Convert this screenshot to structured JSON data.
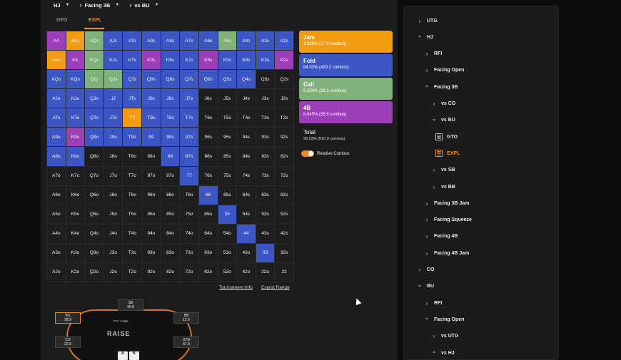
{
  "breadcrumb": [
    {
      "label": "HJ",
      "chev": false
    },
    {
      "label": "Facing 3B",
      "chev": true
    },
    {
      "label": "vs BU",
      "chev": true
    }
  ],
  "tabs": [
    "GTO",
    "EXPL"
  ],
  "active_tab": "EXPL",
  "colors": {
    "jam": "#f39c12",
    "fold": "#3d56c6",
    "call": "#7fb27a",
    "bet4": "#9c3fb8",
    "none": "#1e1e1e",
    "accent": "#f08a24"
  },
  "grid": {
    "rows": [
      [
        "AA",
        "AKs",
        "AQs",
        "AJs",
        "ATs",
        "A9s",
        "A8s",
        "A7s",
        "A6s",
        "A5s",
        "A4s",
        "A3s",
        "A2s"
      ],
      [
        "AKo",
        "KK",
        "KQs",
        "KJs",
        "KTs",
        "K9s",
        "K8s",
        "K7s",
        "K6s",
        "K5s",
        "K4s",
        "K3s",
        "K2s"
      ],
      [
        "AQo",
        "KQo",
        "QQ",
        "QJs",
        "QTs",
        "Q9s",
        "Q8s",
        "Q7s",
        "Q6s",
        "Q5s",
        "Q4s",
        "Q3s",
        "Q2s"
      ],
      [
        "AJo",
        "KJo",
        "QJo",
        "JJ",
        "JTs",
        "J9s",
        "J8s",
        "J7s",
        "J6s",
        "J5s",
        "J4s",
        "J3s",
        "J2s"
      ],
      [
        "ATo",
        "KTo",
        "QTo",
        "JTo",
        "TT",
        "T9s",
        "T8s",
        "T7s",
        "T6s",
        "T5s",
        "T4s",
        "T3s",
        "T2s"
      ],
      [
        "A9o",
        "K9o",
        "Q9o",
        "J9o",
        "T9o",
        "99",
        "98s",
        "97s",
        "96s",
        "95s",
        "94s",
        "93s",
        "92s"
      ],
      [
        "A8o",
        "K8o",
        "Q8o",
        "J8o",
        "T8o",
        "98o",
        "88",
        "87s",
        "86s",
        "85s",
        "84s",
        "83s",
        "82s"
      ],
      [
        "A7o",
        "K7o",
        "Q7o",
        "J7o",
        "T7o",
        "97o",
        "87o",
        "77",
        "76s",
        "75s",
        "74s",
        "73s",
        "72s"
      ],
      [
        "A6o",
        "K6o",
        "Q6o",
        "J6o",
        "T6o",
        "96o",
        "86o",
        "76o",
        "66",
        "65s",
        "64s",
        "63s",
        "62s"
      ],
      [
        "A5o",
        "K5o",
        "Q5o",
        "J5o",
        "T5o",
        "95o",
        "85o",
        "75o",
        "65o",
        "55",
        "54s",
        "53s",
        "52s"
      ],
      [
        "A4o",
        "K4o",
        "Q4o",
        "J4o",
        "T4o",
        "94o",
        "84o",
        "74o",
        "64o",
        "54o",
        "44",
        "43s",
        "42s"
      ],
      [
        "A3o",
        "K3o",
        "Q3o",
        "J3o",
        "T3o",
        "93o",
        "83o",
        "73o",
        "63o",
        "53o",
        "43o",
        "33",
        "32s"
      ],
      [
        "A2o",
        "K2o",
        "Q2o",
        "J2o",
        "T2o",
        "92o",
        "82o",
        "72o",
        "62o",
        "52o",
        "42o",
        "32o",
        "22"
      ]
    ],
    "colors": [
      [
        "bet4",
        "jam",
        "call",
        "fold",
        "fold",
        "fold",
        "fold",
        "fold",
        "fold",
        "call",
        "fold",
        "fold",
        "fold"
      ],
      [
        "jam",
        "bet4",
        "call",
        "fold",
        "fold",
        "bet4",
        "fold",
        "fold",
        "bet4",
        "fold",
        "fold",
        "fold",
        "bet4"
      ],
      [
        "fold",
        "fold",
        "call",
        "call",
        "fold",
        "fold",
        "fold",
        "fold",
        "fold",
        "fold",
        "fold",
        "none",
        "none"
      ],
      [
        "fold",
        "fold",
        "fold",
        "fold",
        "fold",
        "fold",
        "fold",
        "fold",
        "none",
        "none",
        "none",
        "none",
        "none"
      ],
      [
        "fold",
        "fold",
        "fold",
        "fold",
        "jam",
        "fold",
        "fold",
        "fold",
        "none",
        "none",
        "none",
        "none",
        "none"
      ],
      [
        "fold",
        "bet4",
        "fold",
        "fold",
        "fold",
        "fold",
        "fold",
        "fold",
        "none",
        "none",
        "none",
        "none",
        "none"
      ],
      [
        "fold",
        "fold",
        "none",
        "none",
        "none",
        "none",
        "fold",
        "fold",
        "none",
        "none",
        "none",
        "none",
        "none"
      ],
      [
        "none",
        "none",
        "none",
        "none",
        "none",
        "none",
        "none",
        "fold",
        "none",
        "none",
        "none",
        "none",
        "none"
      ],
      [
        "none",
        "none",
        "none",
        "none",
        "none",
        "none",
        "none",
        "none",
        "fold",
        "none",
        "none",
        "none",
        "none"
      ],
      [
        "none",
        "none",
        "none",
        "none",
        "none",
        "none",
        "none",
        "none",
        "none",
        "fold",
        "none",
        "none",
        "none"
      ],
      [
        "none",
        "none",
        "none",
        "none",
        "none",
        "none",
        "none",
        "none",
        "none",
        "none",
        "fold",
        "none",
        "none"
      ],
      [
        "none",
        "none",
        "none",
        "none",
        "none",
        "none",
        "none",
        "none",
        "none",
        "none",
        "none",
        "fold",
        "none"
      ],
      [
        "none",
        "none",
        "none",
        "none",
        "none",
        "none",
        "none",
        "none",
        "none",
        "none",
        "none",
        "none",
        "none"
      ]
    ]
  },
  "actions": [
    {
      "name": "Jam",
      "stat": "3.389% (17.0 combos)",
      "color": "jam"
    },
    {
      "name": "Fold",
      "stat": "84.02% (429.2 combos)",
      "color": "fold"
    },
    {
      "name": "Call",
      "stat": "5.530% (28.3 combos)",
      "color": "call"
    },
    {
      "name": "4B",
      "stat": "6.945% (35.5 combos)",
      "color": "bet4"
    }
  ],
  "total": {
    "label": "Total",
    "value": "38.53% (510.9 combos)"
  },
  "relative_combos": "Relative Combos",
  "links": [
    "Tournament Info",
    "Export Range"
  ],
  "table": {
    "logo": "RAISE",
    "seats": [
      {
        "pos": "SB",
        "stack": "46.9"
      },
      {
        "pos": "BB",
        "stack": "12.9"
      },
      {
        "pos": "BU",
        "stack": "28.9"
      },
      {
        "pos": "CO",
        "stack": "22.9"
      },
      {
        "pos": "UTG",
        "stack": "67.9"
      }
    ],
    "pot": "Pot: 2.865",
    "hero_cards": [
      "A",
      "K"
    ]
  },
  "tree": [
    {
      "label": "UTG",
      "icon": "chevron-right",
      "indent": 0
    },
    {
      "label": "HJ",
      "icon": "chevron-down",
      "indent": 0
    },
    {
      "label": "RFI",
      "icon": "chevron-right",
      "indent": 1
    },
    {
      "label": "Facing Open",
      "icon": "chevron-right",
      "indent": 1
    },
    {
      "label": "Facing 3B",
      "icon": "chevron-down",
      "indent": 1
    },
    {
      "label": "vs CO",
      "icon": "chevron-right",
      "indent": 2
    },
    {
      "label": "vs BU",
      "icon": "chevron-down",
      "indent": 2
    },
    {
      "label": "GTO",
      "icon": "grid",
      "indent": 3
    },
    {
      "label": "EXPL",
      "icon": "grid",
      "indent": 3,
      "selected": true
    },
    {
      "label": "vs SB",
      "icon": "chevron-right",
      "indent": 2
    },
    {
      "label": "vs BB",
      "icon": "chevron-right",
      "indent": 2
    },
    {
      "label": "Facing 3B Jam",
      "icon": "chevron-right",
      "indent": 1
    },
    {
      "label": "Facing Squeeze",
      "icon": "chevron-right",
      "indent": 1
    },
    {
      "label": "Facing 4B",
      "icon": "chevron-right",
      "indent": 1
    },
    {
      "label": "Facing 4B Jam",
      "icon": "chevron-right",
      "indent": 1
    },
    {
      "label": "CO",
      "icon": "chevron-right",
      "indent": 0
    },
    {
      "label": "BU",
      "icon": "chevron-down",
      "indent": 0
    },
    {
      "label": "RFI",
      "icon": "chevron-right",
      "indent": 1
    },
    {
      "label": "Facing Open",
      "icon": "chevron-down",
      "indent": 1
    },
    {
      "label": "vs UTG",
      "icon": "chevron-right",
      "indent": 2
    },
    {
      "label": "vs HJ",
      "icon": "chevron-down",
      "indent": 2
    }
  ]
}
